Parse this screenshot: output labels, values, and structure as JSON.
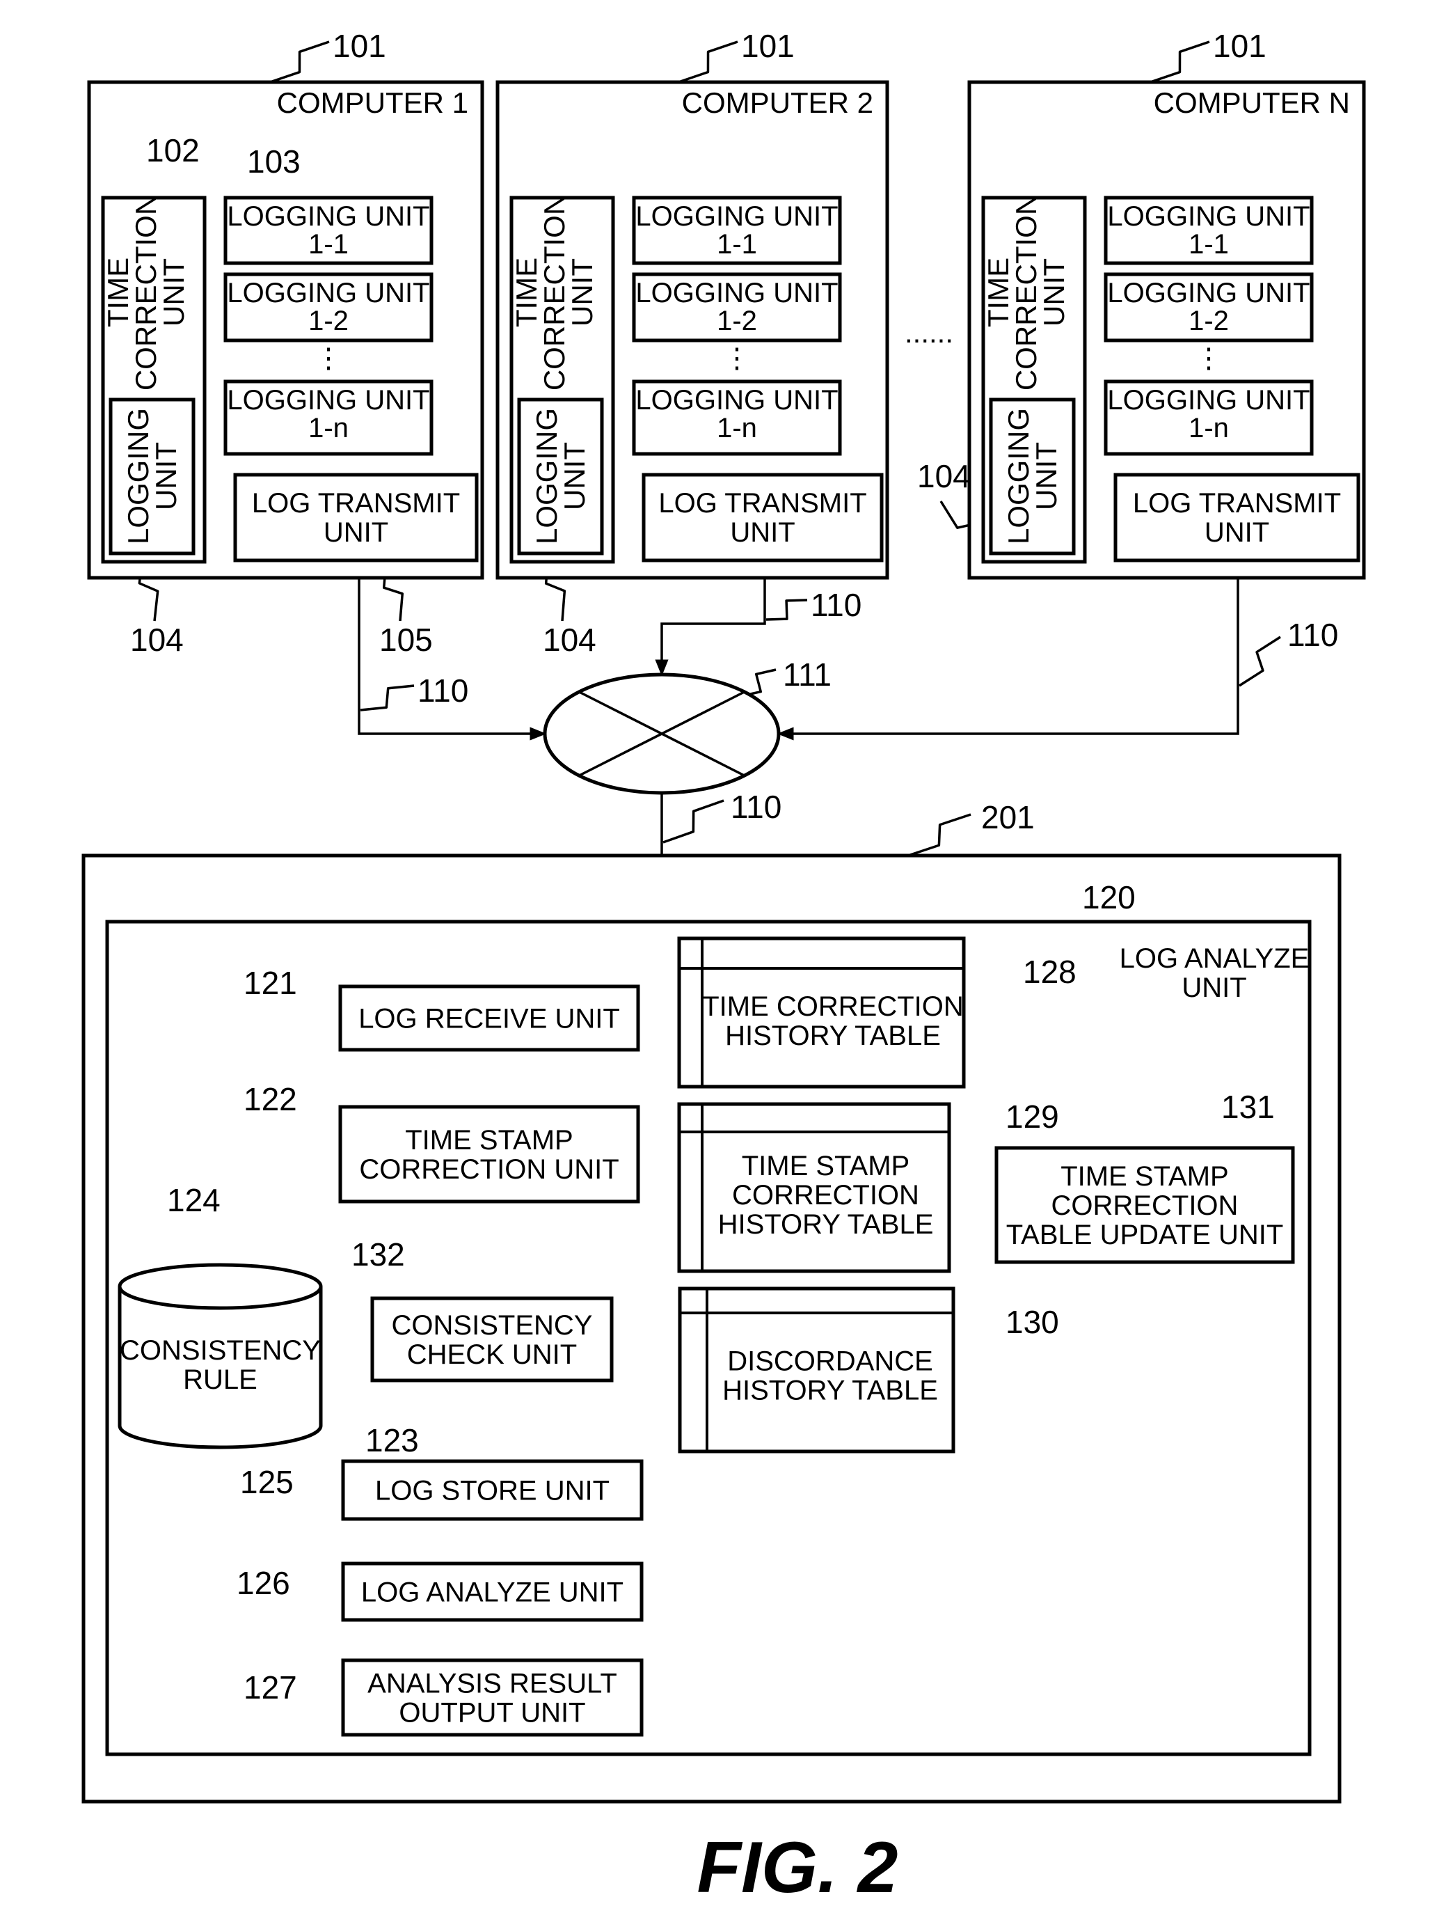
{
  "figure": {
    "caption": "FIG. 2",
    "colors": {
      "ink": "#000000",
      "paper": "#ffffff"
    }
  },
  "computers": [
    {
      "title": "COMPUTER 1",
      "ref": "101",
      "time_correction_unit": {
        "label": [
          "TIME",
          "CORRECTION",
          "UNIT"
        ],
        "ref": "102"
      },
      "inner_logging_unit": {
        "label": [
          "LOGGING",
          "UNIT"
        ],
        "ref": "104"
      },
      "logging_units": [
        {
          "line1": "LOGGING UNIT",
          "line2": "1-1"
        },
        {
          "line1": "LOGGING UNIT",
          "line2": "1-2"
        },
        {
          "line1": "LOGGING UNIT",
          "line2": "1-n"
        }
      ],
      "logging_units_ref": "103",
      "ellipsis": "⋮",
      "log_transmit_unit": {
        "line1": "LOG TRANSMIT",
        "line2": "UNIT",
        "ref": "105"
      },
      "link_ref": "110"
    },
    {
      "title": "COMPUTER 2",
      "ref": "101",
      "time_correction_unit": {
        "label": [
          "TIME",
          "CORRECTION",
          "UNIT"
        ]
      },
      "inner_logging_unit": {
        "label": [
          "LOGGING",
          "UNIT"
        ],
        "ref": "104"
      },
      "logging_units": [
        {
          "line1": "LOGGING UNIT",
          "line2": "1-1"
        },
        {
          "line1": "LOGGING UNIT",
          "line2": "1-2"
        },
        {
          "line1": "LOGGING UNIT",
          "line2": "1-n"
        }
      ],
      "ellipsis": "⋮",
      "log_transmit_unit": {
        "line1": "LOG TRANSMIT",
        "line2": "UNIT"
      },
      "link_ref": "110"
    },
    {
      "title": "COMPUTER N",
      "ref": "101",
      "time_correction_unit": {
        "label": [
          "TIME",
          "CORRECTION",
          "UNIT"
        ]
      },
      "inner_logging_unit": {
        "label": [
          "LOGGING",
          "UNIT"
        ],
        "ref": "104"
      },
      "logging_units": [
        {
          "line1": "LOGGING UNIT",
          "line2": "1-1"
        },
        {
          "line1": "LOGGING UNIT",
          "line2": "1-2"
        },
        {
          "line1": "LOGGING UNIT",
          "line2": "1-n"
        }
      ],
      "ellipsis": "⋮",
      "log_transmit_unit": {
        "line1": "LOG TRANSMIT",
        "line2": "UNIT"
      },
      "link_ref": "110"
    }
  ],
  "between_computers_ellipsis": "......",
  "network": {
    "ref": "111",
    "downlink_ref": "110"
  },
  "server": {
    "ref": "201",
    "log_analyze_unit": {
      "ref": "120",
      "title": [
        "LOG ANALYZE",
        "UNIT"
      ],
      "blocks": {
        "log_receive": {
          "lines": [
            "LOG RECEIVE UNIT"
          ],
          "ref": "121"
        },
        "ts_correction": {
          "lines": [
            "TIME STAMP",
            "CORRECTION UNIT"
          ],
          "ref": "122"
        },
        "consistency_check": {
          "lines": [
            "CONSISTENCY",
            "CHECK UNIT"
          ],
          "ref": "123"
        },
        "consistency_rule": {
          "lines": [
            "CONSISTENCY",
            "RULE"
          ],
          "ref": "124"
        },
        "log_store": {
          "lines": [
            "LOG STORE UNIT"
          ],
          "ref": "125"
        },
        "log_analyze": {
          "lines": [
            "LOG ANALYZE UNIT"
          ],
          "ref": "126"
        },
        "analysis_output": {
          "lines": [
            "ANALYSIS RESULT",
            "OUTPUT UNIT"
          ],
          "ref": "127"
        },
        "time_correction_table": {
          "lines": [
            "TIME CORRECTION",
            "HISTORY TABLE"
          ],
          "ref": "128"
        },
        "ts_correction_table": {
          "lines": [
            "TIME STAMP",
            "CORRECTION",
            "HISTORY TABLE"
          ],
          "ref": "129"
        },
        "discordance_table": {
          "lines": [
            "DISCORDANCE",
            "HISTORY TABLE"
          ],
          "ref": "130"
        },
        "ts_table_update": {
          "lines": [
            "TIME STAMP",
            "CORRECTION",
            "TABLE UPDATE UNIT"
          ],
          "ref": "131"
        }
      },
      "bidirectional_link_ref": "132"
    }
  }
}
